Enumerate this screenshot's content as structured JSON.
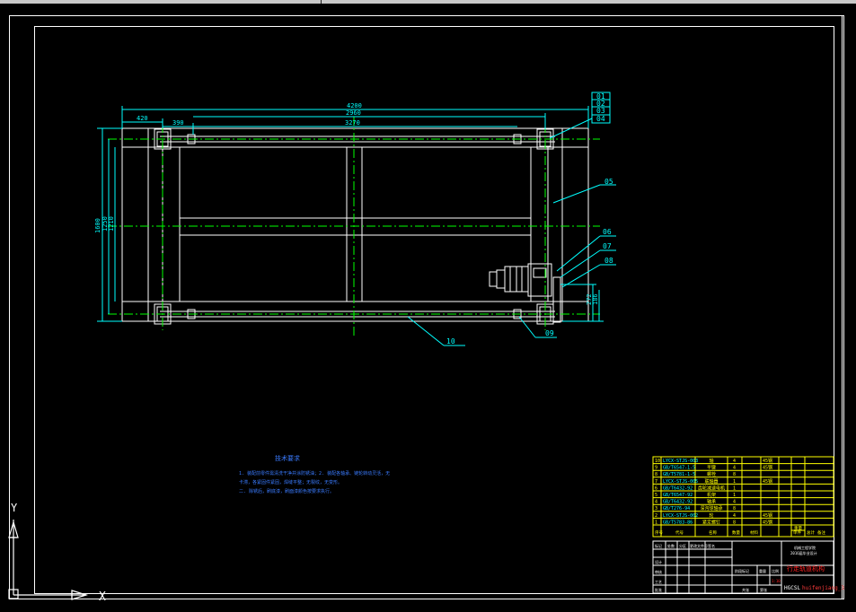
{
  "drawing": {
    "overall_length": "4200",
    "left_offset": "420",
    "bearing_offset": "390",
    "inner_span": "3270",
    "inner_span_2": "2960",
    "overall_width": "1600",
    "inner_width": "1250",
    "inner_width_2": "1210",
    "motor_offset": "272",
    "motor_height": "186",
    "balloons": [
      "01",
      "02",
      "03",
      "04",
      "05",
      "06",
      "07",
      "08",
      "09",
      "10"
    ]
  },
  "notes": {
    "title": "技术要求",
    "lines": [
      "1. 装配前零件需清洗干净并涂防锈油；2. 装配各轴承、链轮转动灵活，无",
      "卡滞，各紧固件紧固，焊缝平整；无裂纹，无变形。",
      "二. 除锈后，刷底漆，刷面漆颜色按要求执行。"
    ]
  },
  "bom": {
    "rows": [
      {
        "no": "10",
        "code": "LYCX-STJS-003",
        "name": "轴",
        "qty": "4",
        "mat": "45钢"
      },
      {
        "no": "9",
        "code": "GB/T6547-1-5",
        "name": "平键",
        "qty": "4",
        "mat": "45钢"
      },
      {
        "no": "8",
        "code": "GB/T5781-1-5",
        "name": "螺栓",
        "qty": "8",
        "mat": ""
      },
      {
        "no": "7",
        "code": "LYCX-STJS-005",
        "name": "联轴器",
        "qty": "1",
        "mat": "45钢"
      },
      {
        "no": "6",
        "code": "GB/T6432-92",
        "name": "齿轮减速电机",
        "qty": "1",
        "mat": ""
      },
      {
        "no": "5",
        "code": "GB/T6547-92",
        "name": "机架",
        "qty": "1",
        "mat": ""
      },
      {
        "no": "4",
        "code": "GB/T6432-92",
        "name": "轴承",
        "qty": "4",
        "mat": ""
      },
      {
        "no": "3",
        "code": "GB/T276-94",
        "name": "深沟球轴承",
        "qty": "8",
        "mat": ""
      },
      {
        "no": "2",
        "code": "LYCX-STJS-002",
        "name": "轮",
        "qty": "4",
        "mat": "45钢"
      },
      {
        "no": "1",
        "code": "GB/T5783-86",
        "name": "紧定螺钉",
        "qty": "8",
        "mat": "45钢"
      }
    ],
    "header": [
      "序号",
      "代号",
      "名称",
      "数量",
      "材料",
      "单件",
      "总计",
      "备注"
    ],
    "weight_header": "重量"
  },
  "title_block": {
    "drawing_name": "行走轨道机构",
    "company": "HGCSL",
    "watermark": "huifenjiang_3",
    "subtitle_1": "机械工程学院",
    "subtitle_2": "2016届毕业设计",
    "labels": [
      "标记",
      "处数",
      "分区",
      "更改文件号",
      "签名",
      "设计",
      "审核",
      "工艺",
      "批准",
      "阶段标记",
      "重量",
      "比例",
      "共张",
      "第张"
    ],
    "scale": "1:10"
  },
  "ucs": {
    "x": "X",
    "y": "Y"
  },
  "colors": {
    "background": "#000000",
    "geometry": "#ffffff",
    "dims": "#00ffff",
    "center": "#00ff00",
    "table": "#ffff00",
    "border": "#ffffff",
    "accent": "#ff2020"
  }
}
